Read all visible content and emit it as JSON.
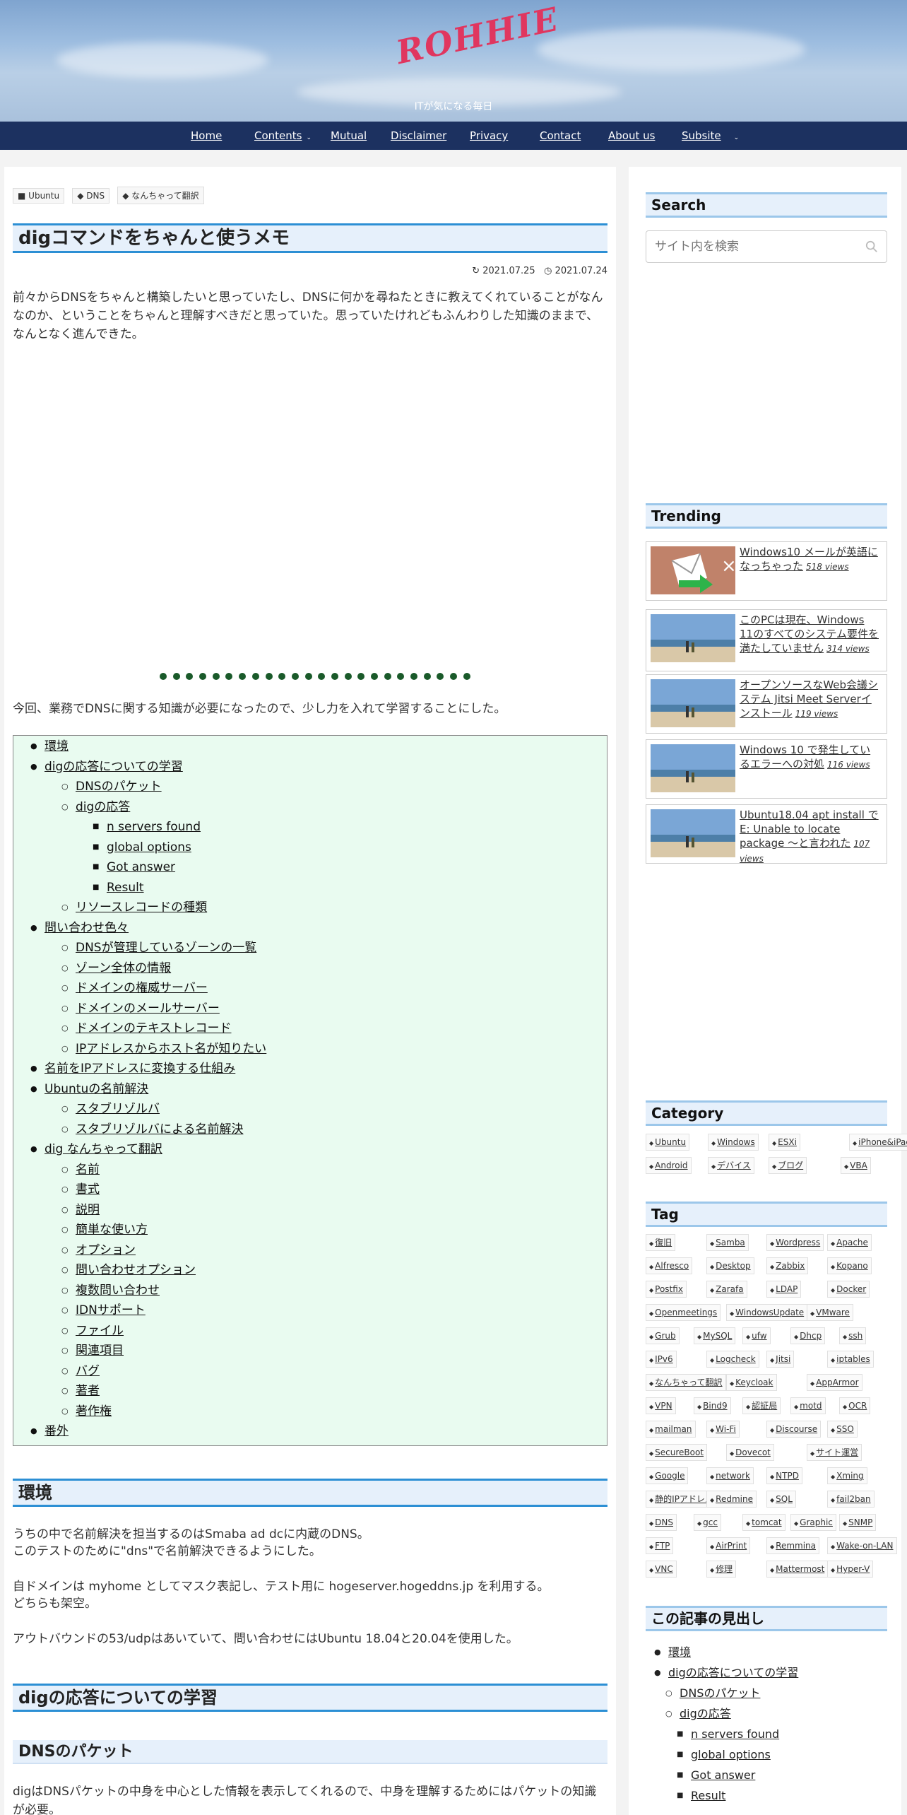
{
  "header": {
    "logo_text": "ROHHIE",
    "tagline": "ITが気になる毎日"
  },
  "nav": [
    {
      "label": "Home",
      "dropdown": false
    },
    {
      "label": "Contents",
      "dropdown": true
    },
    {
      "label": "Mutual",
      "dropdown": false
    },
    {
      "label": "Disclaimer",
      "dropdown": false
    },
    {
      "label": "Privacy",
      "dropdown": false
    },
    {
      "label": "Contact",
      "dropdown": false
    },
    {
      "label": "About us",
      "dropdown": false
    },
    {
      "label": "Subsite",
      "dropdown": true
    }
  ],
  "article": {
    "categories": [
      "Ubuntu",
      "DNS",
      "なんちゃって翻訳"
    ],
    "title": "digコマンドをちゃんと使うメモ",
    "updated": "2021.07.25",
    "published": "2021.07.24",
    "intro": "前々からDNSをちゃんと構築したいと思っていたし、DNSに何かを尋ねたときに教えてくれていることがなんなのか、ということをちゃんと理解すべきだと思っていた。思っていたけれどもふんわりした知識のままで、なんとなく進んできた。",
    "lead": "今回、業務でDNSに関する知識が必要になったので、少し力を入れて学習することにした。",
    "toc": [
      {
        "label": "環境",
        "level": 1
      },
      {
        "label": "digの応答についての学習",
        "level": 1
      },
      {
        "label": "DNSのパケット",
        "level": 2
      },
      {
        "label": "digの応答",
        "level": 2
      },
      {
        "label": "n servers found",
        "level": 3
      },
      {
        "label": "global options",
        "level": 3
      },
      {
        "label": "Got answer",
        "level": 3
      },
      {
        "label": "Result",
        "level": 3
      },
      {
        "label": "リソースレコードの種類",
        "level": 2
      },
      {
        "label": "問い合わせ色々",
        "level": 1
      },
      {
        "label": "DNSが管理しているゾーンの一覧",
        "level": 2
      },
      {
        "label": "ゾーン全体の情報",
        "level": 2
      },
      {
        "label": "ドメインの権威サーバー",
        "level": 2
      },
      {
        "label": "ドメインのメールサーバー",
        "level": 2
      },
      {
        "label": "ドメインのテキストレコード",
        "level": 2
      },
      {
        "label": "IPアドレスからホスト名が知りたい",
        "level": 2
      },
      {
        "label": "名前をIPアドレスに変換する仕組み",
        "level": 1
      },
      {
        "label": "Ubuntuの名前解決",
        "level": 1
      },
      {
        "label": "スタブリゾルバ",
        "level": 2
      },
      {
        "label": "スタブリゾルバによる名前解決",
        "level": 2
      },
      {
        "label": "dig なんちゃって翻訳",
        "level": 1
      },
      {
        "label": "名前",
        "level": 2
      },
      {
        "label": "書式",
        "level": 2
      },
      {
        "label": "説明",
        "level": 2
      },
      {
        "label": "簡単な使い方",
        "level": 2
      },
      {
        "label": "オプション",
        "level": 2
      },
      {
        "label": "問い合わせオプション",
        "level": 2
      },
      {
        "label": "複数問い合わせ",
        "level": 2
      },
      {
        "label": "IDNサポート",
        "level": 2
      },
      {
        "label": "ファイル",
        "level": 2
      },
      {
        "label": "関連項目",
        "level": 2
      },
      {
        "label": "バグ",
        "level": 2
      },
      {
        "label": "著者",
        "level": 2
      },
      {
        "label": "著作権",
        "level": 2
      },
      {
        "label": "番外",
        "level": 1
      }
    ],
    "section1_title": "環境",
    "section1_lines": [
      "うちの中で名前解決を担当するのはSmaba ad dcに内蔵のDNS。",
      "このテストのために\"dns\"で名前解決できるようにした。",
      "自ドメインは myhome としてマスク表記し、テスト用に hogeserver.hogeddns.jp を利用する。",
      "どちらも架空。",
      "アウトバウンドの53/udpはあいていて、問い合わせにはUbuntu 18.04と20.04を使用した。"
    ],
    "section2_title": "digの応答についての学習",
    "section2_sub": "DNSのパケット",
    "section2_text": "digはDNSパケットの中身を中心とした情報を表示してくれるので、中身を理解するためにはパケットの知識が必要。"
  },
  "sidebar": {
    "search_title": "Search",
    "search_placeholder": "サイト内を検索",
    "trending_title": "Trending",
    "trending": [
      {
        "title": "Windows10 メールが英語になっちゃった",
        "views": "518 views"
      },
      {
        "title": "このPCは現在、Windows 11のすべてのシステム要件を満たしていません",
        "views": "314 views"
      },
      {
        "title": "オープンソースなWeb会議システム Jitsi Meet Serverインストール",
        "views": "119 views"
      },
      {
        "title": "Windows 10 で発生しているエラーへの対処",
        "views": "116 views"
      },
      {
        "title": "Ubuntu18.04 apt install で E: Unable to locate package ～と言われた",
        "views": "107 views"
      }
    ],
    "category_title": "Category",
    "categories": [
      "Ubuntu",
      "Windows",
      "ESXi",
      "iPhone&iPad",
      "Android",
      "デバイス",
      "ブログ",
      "VBA"
    ],
    "tag_title": "Tag",
    "tags": [
      [
        "復旧",
        "Samba",
        "Wordpress",
        "Apache"
      ],
      [
        "Alfresco",
        "Desktop",
        "Zabbix",
        "Kopano"
      ],
      [
        "Postfix",
        "Zarafa",
        "LDAP",
        "Docker"
      ],
      [
        "Openmeetings",
        "WindowsUpdate",
        "VMware"
      ],
      [
        "Grub",
        "MySQL",
        "ufw",
        "Dhcp",
        "ssh"
      ],
      [
        "IPv6",
        "Logcheck",
        "Jitsi",
        "iptables"
      ],
      [
        "なんちゃって翻訳",
        "Keycloak",
        "AppArmor"
      ],
      [
        "VPN",
        "Bind9",
        "認証局",
        "motd",
        "OCR"
      ],
      [
        "mailman",
        "Wi-Fi",
        "Discourse",
        "SSO"
      ],
      [
        "SecureBoot",
        "Dovecot",
        "サイト運営"
      ],
      [
        "Google",
        "network",
        "NTPD",
        "Xming"
      ],
      [
        "静的IPアドレス",
        "Redmine",
        "SQL",
        "fail2ban"
      ],
      [
        "DNS",
        "gcc",
        "tomcat",
        "Graphic",
        "SNMP"
      ],
      [
        "FTP",
        "AirPrint",
        "Remmina",
        "Wake-on-LAN"
      ],
      [
        "VNC",
        "修理",
        "Mattermost",
        "Hyper-V"
      ]
    ],
    "outline_title": "この記事の見出し",
    "outline": [
      {
        "label": "環境",
        "level": 1
      },
      {
        "label": "digの応答についての学習",
        "level": 1
      },
      {
        "label": "DNSのパケット",
        "level": 2
      },
      {
        "label": "digの応答",
        "level": 2
      },
      {
        "label": "n servers found",
        "level": 3
      },
      {
        "label": "global options",
        "level": 3
      },
      {
        "label": "Got answer",
        "level": 3
      },
      {
        "label": "Result",
        "level": 3
      }
    ]
  }
}
